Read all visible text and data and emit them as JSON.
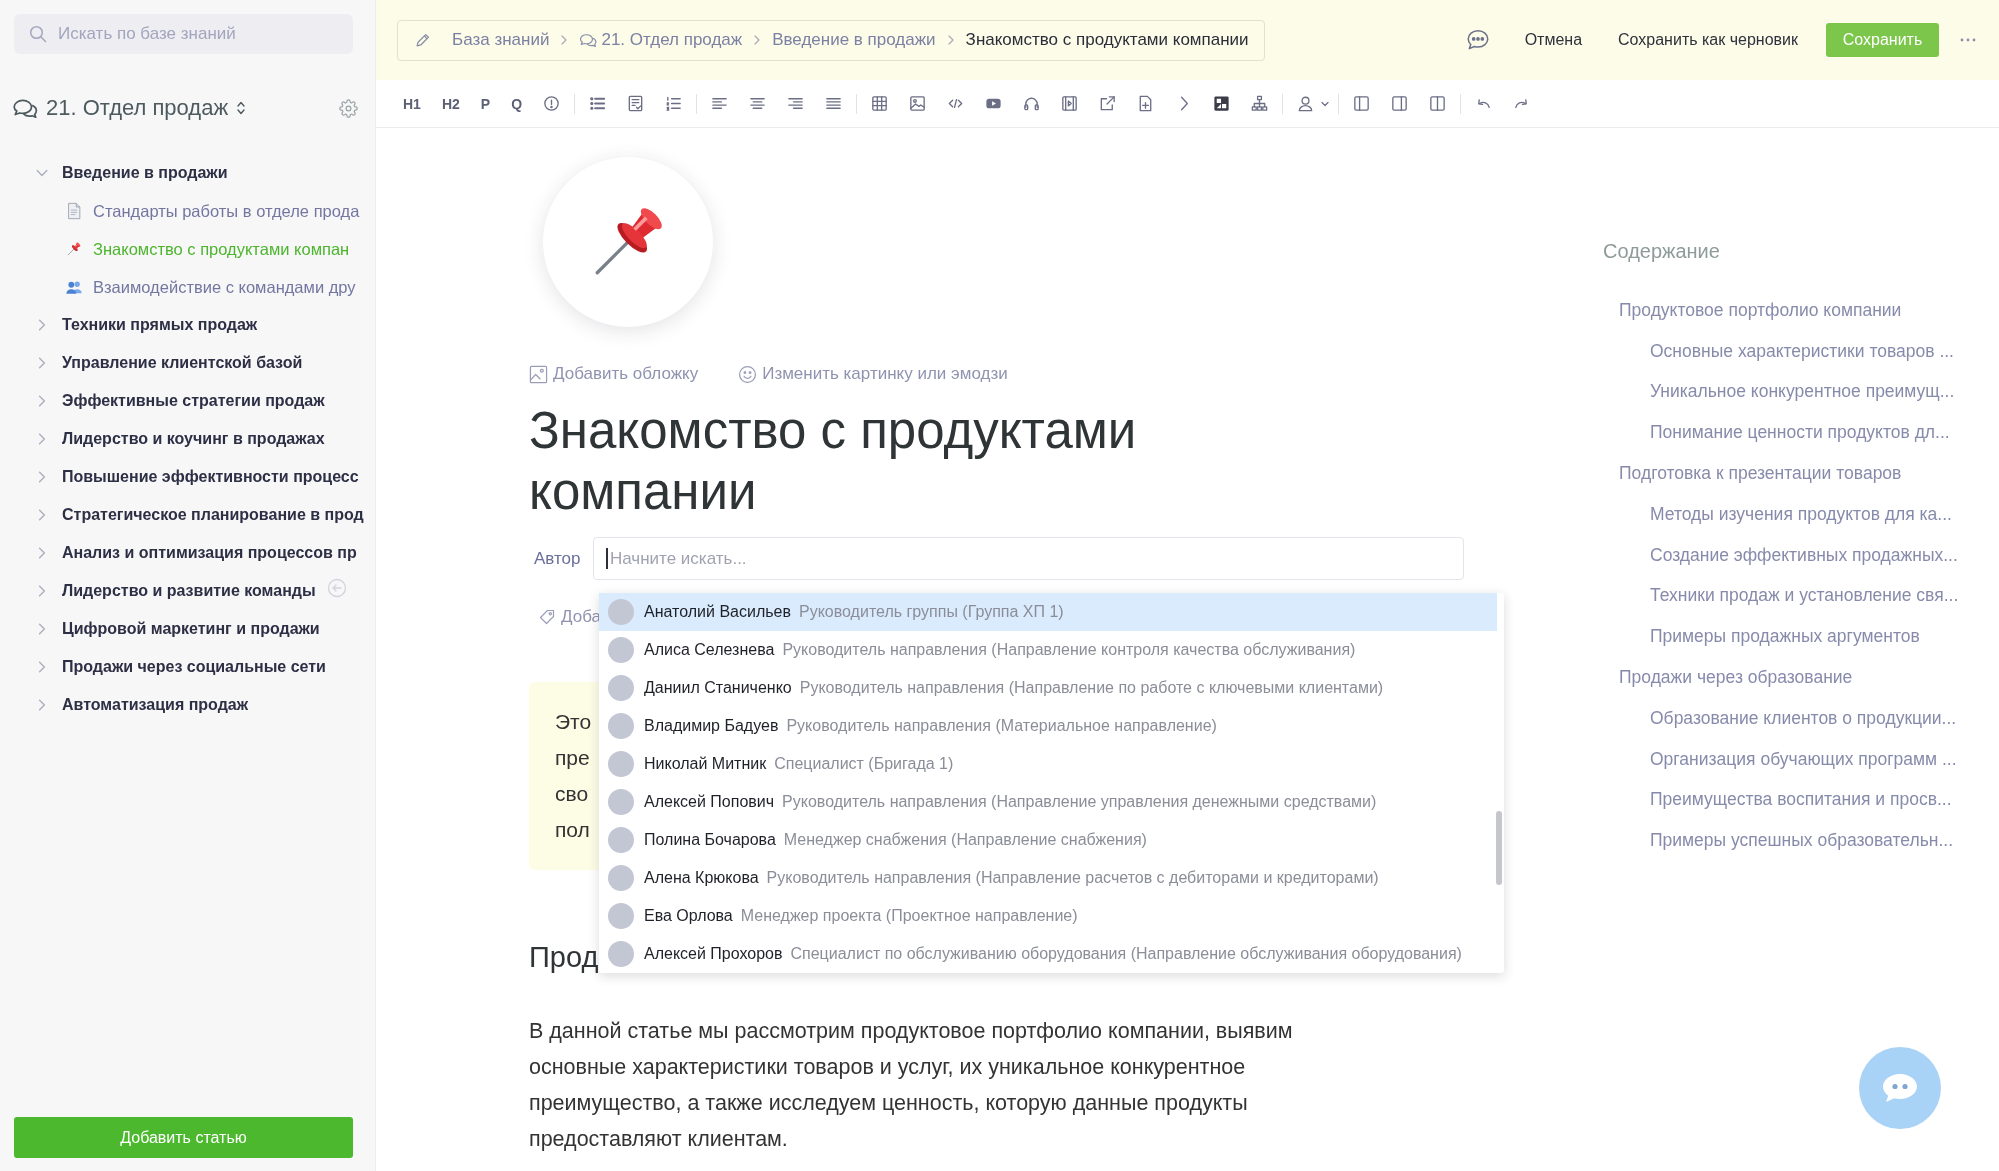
{
  "sidebar": {
    "search": {
      "placeholder": "Искать по базе знаний"
    },
    "space": {
      "title": "21. Отдел продаж"
    },
    "tree": [
      {
        "label": "Введение в продажи",
        "expanded": true,
        "selected": false,
        "children": [
          {
            "label": "Стандарты работы в отделе прода",
            "kind": "document",
            "selected": false
          },
          {
            "label": "Знакомство с продуктами компан",
            "kind": "pin",
            "selected": true
          },
          {
            "label": "Взаимодействие с командами дру",
            "kind": "people",
            "selected": false
          }
        ]
      },
      {
        "label": "Техники прямых продаж",
        "expanded": false,
        "selected": false
      },
      {
        "label": "Управление клиентской базой",
        "expanded": false,
        "selected": false
      },
      {
        "label": "Эффективные стратегии продаж",
        "expanded": false,
        "selected": false
      },
      {
        "label": "Лидерство и коучинг в продажах",
        "expanded": false,
        "selected": false
      },
      {
        "label": "Повышение эффективности процесс",
        "expanded": false,
        "selected": false
      },
      {
        "label": "Стратегическое планирование в прод",
        "expanded": false,
        "selected": false
      },
      {
        "label": "Анализ и оптимизация процессов пр",
        "expanded": false,
        "selected": false
      },
      {
        "label": "Лидерство и развитие команды",
        "expanded": false,
        "selected": false
      },
      {
        "label": "Цифровой маркетинг и продажи",
        "expanded": false,
        "selected": false
      },
      {
        "label": "Продажи через социальные сети",
        "expanded": false,
        "selected": false
      },
      {
        "label": "Автоматизация продаж",
        "expanded": false,
        "selected": false
      }
    ],
    "add_button": "Добавить статью"
  },
  "topbar": {
    "breadcrumbs": [
      {
        "label": "База знаний",
        "kind": "page",
        "current": false
      },
      {
        "label": "21. Отдел продаж",
        "kind": "space",
        "current": false
      },
      {
        "label": "Введение в продажи",
        "kind": "page",
        "current": false
      },
      {
        "label": "Знакомство с продуктами компании",
        "kind": "page",
        "current": true
      }
    ],
    "cancel": "Отмена",
    "draft": "Сохранить как черновик",
    "save": "Сохранить"
  },
  "toolbar": {
    "text_buttons": [
      "H1",
      "H2",
      "P",
      "Q"
    ]
  },
  "article": {
    "cover_actions": [
      {
        "kind": "cover",
        "label": "Добавить обложку"
      },
      {
        "kind": "emoji",
        "label": "Изменить картинку или эмодзи"
      }
    ],
    "title": "Знакомство с продуктами компании",
    "author": {
      "label": "Автор",
      "placeholder": "Начните искать..."
    },
    "tags": {
      "label": "Доба"
    },
    "callout_lines": [
      "Это",
      "пре",
      "сво",
      "пол"
    ],
    "heading": "Прод",
    "paragraph": "В данной статье мы рассмотрим продуктовое портфолио компании, выявим основные характеристики товаров и услуг, их уникальное конкурентное преимущество, а также исследуем ценность, которую данные продукты предоставляют клиентам."
  },
  "author_dropdown": {
    "options": [
      {
        "name": "Анатолий Васильев",
        "role": "Руководитель группы (Группа ХП 1)",
        "selected": true
      },
      {
        "name": "Алиса Селезнева",
        "role": "Руководитель направления (Направление контроля качества обслуживания)",
        "selected": false
      },
      {
        "name": "Даниил Станиченко",
        "role": "Руководитель направления (Направление по работе с ключевыми клиентами)",
        "selected": false
      },
      {
        "name": "Владимир Бадуев",
        "role": "Руководитель направления (Материальное направление)",
        "selected": false
      },
      {
        "name": "Николай Митник",
        "role": "Специалист (Бригада 1)",
        "selected": false
      },
      {
        "name": "Алексей Попович",
        "role": "Руководитель направления (Направление управления денежными средствами)",
        "selected": false
      },
      {
        "name": "Полина Бочарова",
        "role": "Менеджер снабжения (Направление снабжения)",
        "selected": false
      },
      {
        "name": "Алена Крюкова",
        "role": "Руководитель направления (Направление расчетов с дебиторами и кредиторами)",
        "selected": false
      },
      {
        "name": "Ева Орлова",
        "role": "Менеджер проекта (Проектное направление)",
        "selected": false
      },
      {
        "name": "Алексей Прохоров",
        "role": "Специалист по обслуживанию оборудования (Направление обслуживания оборудования)",
        "selected": false
      }
    ]
  },
  "toc": {
    "title": "Содержание",
    "items": [
      {
        "label": "Продуктовое портфолио компании",
        "children": [
          {
            "label": "Основные характеристики товаров ..."
          },
          {
            "label": "Уникальное конкурентное преимущ..."
          },
          {
            "label": "Понимание ценности продуктов дл..."
          }
        ]
      },
      {
        "label": "Подготовка к презентации товаров",
        "children": [
          {
            "label": "Методы изучения продуктов для ка..."
          },
          {
            "label": "Создание эффективных продажных..."
          },
          {
            "label": "Техники продаж и установление свя..."
          },
          {
            "label": "Примеры продажных аргументов"
          }
        ]
      },
      {
        "label": "Продажи через образование",
        "children": [
          {
            "label": "Образование клиентов о продукции..."
          },
          {
            "label": "Организация обучающих программ ..."
          },
          {
            "label": "Преимущества воспитания и просв..."
          },
          {
            "label": "Примеры успешных образовательн..."
          }
        ]
      }
    ]
  }
}
